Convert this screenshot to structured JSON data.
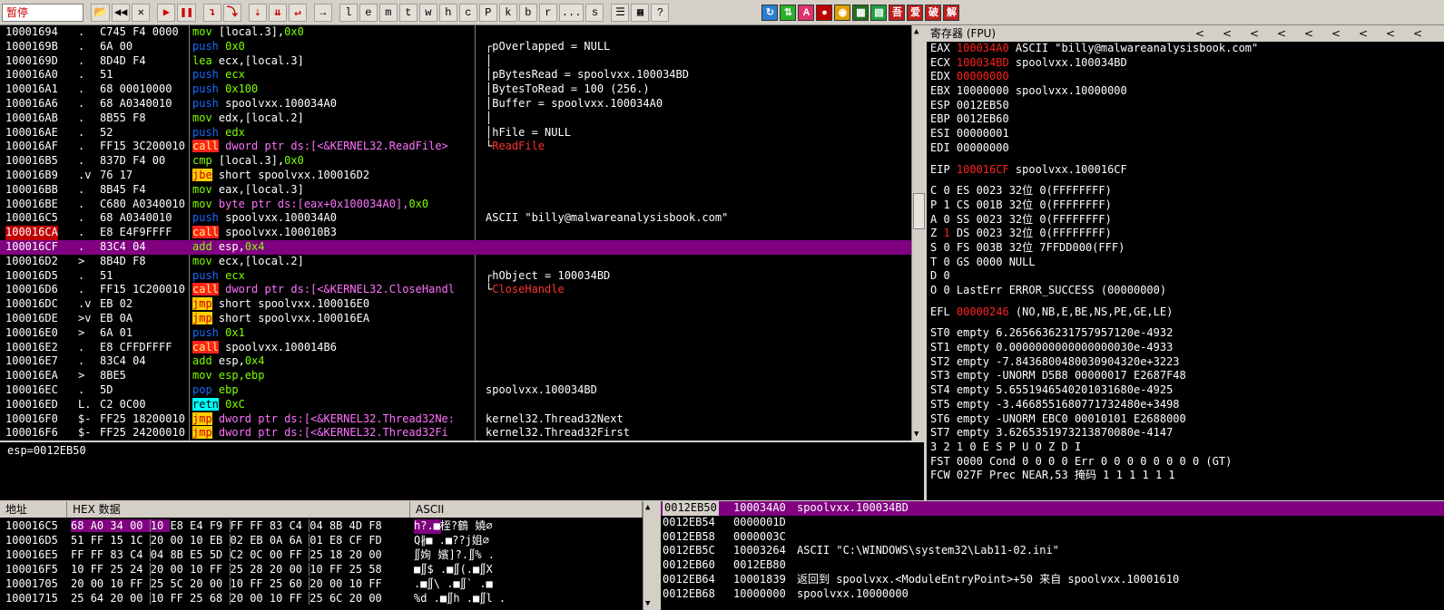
{
  "toolbar": {
    "status": "暂停",
    "buttons": [
      "l",
      "e",
      "m",
      "t",
      "w",
      "h",
      "c",
      "P",
      "k",
      "b",
      "r",
      "...",
      "s"
    ]
  },
  "cpu": {
    "rows": [
      {
        "addr": "10001694",
        "arrow": ".",
        "hex": "C745 F4 0000",
        "dis": [
          [
            "mov",
            "kwmov"
          ],
          [
            " [local.3],",
            "op"
          ],
          [
            "0x0",
            "lit"
          ]
        ],
        "com": ""
      },
      {
        "addr": "1000169B",
        "arrow": ".",
        "hex": "6A 00",
        "dis": [
          [
            "push",
            "kw"
          ],
          [
            " 0x0",
            "lit"
          ]
        ],
        "com": "┌pOverlapped = NULL"
      },
      {
        "addr": "1000169D",
        "arrow": ".",
        "hex": "8D4D F4",
        "dis": [
          [
            "lea",
            "kwmov"
          ],
          [
            " ecx,[local.3]",
            "op"
          ]
        ],
        "com": "│"
      },
      {
        "addr": "100016A0",
        "arrow": ".",
        "hex": "51",
        "dis": [
          [
            "push",
            "kw"
          ],
          [
            " ecx",
            "kwmov"
          ]
        ],
        "com": "│pBytesRead = spoolvxx.100034BD"
      },
      {
        "addr": "100016A1",
        "arrow": ".",
        "hex": "68 00010000",
        "dis": [
          [
            "push",
            "kw"
          ],
          [
            " 0x100",
            "lit"
          ]
        ],
        "com": "│BytesToRead = 100 (256.)"
      },
      {
        "addr": "100016A6",
        "arrow": ".",
        "hex": "68 A0340010",
        "dis": [
          [
            "push",
            "kw"
          ],
          [
            " spoolvxx.100034A0",
            "op"
          ]
        ],
        "com": "│Buffer = spoolvxx.100034A0"
      },
      {
        "addr": "100016AB",
        "arrow": ".",
        "hex": "8B55 F8",
        "dis": [
          [
            "mov",
            "kwmov"
          ],
          [
            " edx,[local.2]",
            "op"
          ]
        ],
        "com": "│"
      },
      {
        "addr": "100016AE",
        "arrow": ".",
        "hex": "52",
        "dis": [
          [
            "push",
            "kw"
          ],
          [
            " edx",
            "kwmov"
          ]
        ],
        "com": "│hFile = NULL"
      },
      {
        "addr": "100016AF",
        "arrow": ".",
        "hex": "FF15 3C200010",
        "dis": [
          [
            "call",
            "kwcall"
          ],
          [
            " dword ptr ds:[<&KERNEL32.ReadFile>",
            "mem"
          ]
        ],
        "com": "└ReadFile",
        "comred": true
      },
      {
        "addr": "100016B5",
        "arrow": ".",
        "hex": "837D F4 00",
        "dis": [
          [
            "cmp",
            "kwcmp"
          ],
          [
            " [local.3],",
            "op"
          ],
          [
            "0x0",
            "lit"
          ]
        ],
        "com": ""
      },
      {
        "addr": "100016B9",
        "arrow": ".v",
        "hex": "76 17",
        "dis": [
          [
            "jbe",
            "kwjmp"
          ],
          [
            " short spoolvxx.100016D2",
            "op"
          ]
        ],
        "com": ""
      },
      {
        "addr": "100016BB",
        "arrow": ".",
        "hex": "8B45 F4",
        "dis": [
          [
            "mov",
            "kwmov"
          ],
          [
            " eax,[local.3]",
            "op"
          ]
        ],
        "com": ""
      },
      {
        "addr": "100016BE",
        "arrow": ".",
        "hex": "C680 A0340010",
        "dis": [
          [
            "mov",
            "kwmov"
          ],
          [
            " byte ptr ds:[eax+0x100034A0],",
            "mem"
          ],
          [
            "0x0",
            "lit"
          ]
        ],
        "com": ""
      },
      {
        "addr": "100016C5",
        "arrow": ".",
        "hex": "68 A0340010",
        "dis": [
          [
            "push",
            "kw"
          ],
          [
            " spoolvxx.100034A0",
            "op"
          ]
        ],
        "com": "ASCII \"billy@malwareanalysisbook.com\""
      },
      {
        "addr": "100016CA",
        "arrow": ".",
        "hex": "E8 E4F9FFFF",
        "dis": [
          [
            "call",
            "kwcall"
          ],
          [
            " spoolvxx.100010B3",
            "op"
          ]
        ],
        "com": "",
        "addrhl": true
      },
      {
        "addr": "100016CF",
        "arrow": ".",
        "hex": "83C4 04",
        "dis": [
          [
            "add",
            "kwmov"
          ],
          [
            " esp,",
            "op"
          ],
          [
            "0x4",
            "lit"
          ]
        ],
        "com": "",
        "sel": true
      },
      {
        "addr": "100016D2",
        "arrow": ">",
        "hex": "8B4D F8",
        "dis": [
          [
            "mov",
            "kwmov"
          ],
          [
            " ecx,[local.2]",
            "op"
          ]
        ],
        "com": ""
      },
      {
        "addr": "100016D5",
        "arrow": ".",
        "hex": "51",
        "dis": [
          [
            "push",
            "kw"
          ],
          [
            " ecx",
            "kwmov"
          ]
        ],
        "com": "┌hObject = 100034BD"
      },
      {
        "addr": "100016D6",
        "arrow": ".",
        "hex": "FF15 1C200010",
        "dis": [
          [
            "call",
            "kwcall"
          ],
          [
            " dword ptr ds:[<&KERNEL32.CloseHandl",
            "mem"
          ]
        ],
        "com": "└CloseHandle",
        "comred": true
      },
      {
        "addr": "100016DC",
        "arrow": ".v",
        "hex": "EB 02",
        "dis": [
          [
            "jmp",
            "kwjmp"
          ],
          [
            " short spoolvxx.100016E0",
            "op"
          ]
        ],
        "com": ""
      },
      {
        "addr": "100016DE",
        "arrow": ">v",
        "hex": "EB 0A",
        "dis": [
          [
            "jmp",
            "kwjmp"
          ],
          [
            " short spoolvxx.100016EA",
            "op"
          ]
        ],
        "com": ""
      },
      {
        "addr": "100016E0",
        "arrow": ">",
        "hex": "6A 01",
        "dis": [
          [
            "push",
            "kw"
          ],
          [
            " 0x1",
            "lit"
          ]
        ],
        "com": ""
      },
      {
        "addr": "100016E2",
        "arrow": ".",
        "hex": "E8 CFFDFFFF",
        "dis": [
          [
            "call",
            "kwcall"
          ],
          [
            " spoolvxx.100014B6",
            "op"
          ]
        ],
        "com": ""
      },
      {
        "addr": "100016E7",
        "arrow": ".",
        "hex": "83C4 04",
        "dis": [
          [
            "add",
            "kwmov"
          ],
          [
            " esp,",
            "op"
          ],
          [
            "0x4",
            "lit"
          ]
        ],
        "com": ""
      },
      {
        "addr": "100016EA",
        "arrow": ">",
        "hex": "8BE5",
        "dis": [
          [
            "mov",
            "kwmov"
          ],
          [
            " esp,ebp",
            "kwmov"
          ]
        ],
        "com": ""
      },
      {
        "addr": "100016EC",
        "arrow": ".",
        "hex": "5D",
        "dis": [
          [
            "pop",
            "kw"
          ],
          [
            " ebp",
            "kwmov"
          ]
        ],
        "com": "spoolvxx.100034BD"
      },
      {
        "addr": "100016ED",
        "arrow": "L.",
        "hex": "C2 0C00",
        "dis": [
          [
            "retn",
            "kwretn"
          ],
          [
            " 0xC",
            "lit"
          ]
        ],
        "com": ""
      },
      {
        "addr": "100016F0",
        "arrow": "$-",
        "hex": "FF25 18200010",
        "dis": [
          [
            "jmp",
            "kwjmp"
          ],
          [
            " dword ptr ds:[<&KERNEL32.Thread32Ne:",
            "mem"
          ]
        ],
        "com": "kernel32.Thread32Next"
      },
      {
        "addr": "100016F6",
        "arrow": "$-",
        "hex": "FF25 24200010",
        "dis": [
          [
            "jmp",
            "kwjmp"
          ],
          [
            " dword ptr ds:[<&KERNEL32.Thread32Fi",
            "mem"
          ]
        ],
        "com": "kernel32.Thread32First"
      }
    ]
  },
  "info": {
    "text": "esp=0012EB50"
  },
  "regs": {
    "title": "寄存器 (FPU)",
    "nav": [
      "<",
      "<",
      "<",
      "<",
      "<",
      "<",
      "<",
      "<",
      "<"
    ],
    "lines": [
      [
        [
          "EAX ",
          ""
        ],
        [
          "100034A0",
          "red"
        ],
        [
          " ASCII \"billy@malwareanalysisbook.com\"",
          ""
        ]
      ],
      [
        [
          "ECX ",
          ""
        ],
        [
          "100034BD",
          "red"
        ],
        [
          " spoolvxx.100034BD",
          ""
        ]
      ],
      [
        [
          "EDX ",
          ""
        ],
        [
          "00000000",
          "red"
        ]
      ],
      [
        [
          "EBX 10000000 spoolvxx.10000000",
          ""
        ]
      ],
      [
        [
          "ESP 0012EB50",
          ""
        ]
      ],
      [
        [
          "EBP 0012EB60",
          ""
        ]
      ],
      [
        [
          "ESI 00000001",
          ""
        ]
      ],
      [
        [
          "EDI 00000000",
          ""
        ]
      ],
      [
        [
          "",
          ""
        ]
      ],
      [
        [
          "EIP ",
          ""
        ],
        [
          "100016CF",
          "red"
        ],
        [
          " spoolvxx.100016CF",
          ""
        ]
      ],
      [
        [
          "",
          ""
        ]
      ],
      [
        [
          "C 0  ES 0023 32位 0(FFFFFFFF)",
          ""
        ]
      ],
      [
        [
          "P 1  CS 001B 32位 0(FFFFFFFF)",
          ""
        ]
      ],
      [
        [
          "A 0  SS 0023 32位 0(FFFFFFFF)",
          ""
        ]
      ],
      [
        [
          "Z ",
          ""
        ],
        [
          "1",
          "red"
        ],
        [
          "  DS 0023 32位 0(FFFFFFFF)",
          ""
        ]
      ],
      [
        [
          "S 0  FS 003B 32位 7FFDD000(FFF)",
          ""
        ]
      ],
      [
        [
          "T 0  GS 0000 NULL",
          ""
        ]
      ],
      [
        [
          "D 0",
          ""
        ]
      ],
      [
        [
          "O 0  LastErr ERROR_SUCCESS (00000000)",
          ""
        ]
      ],
      [
        [
          "",
          ""
        ]
      ],
      [
        [
          "EFL ",
          ""
        ],
        [
          "00000246",
          "red"
        ],
        [
          " (NO,NB,E,BE,NS,PE,GE,LE)",
          ""
        ]
      ],
      [
        [
          "",
          ""
        ]
      ],
      [
        [
          "ST0 empty 6.2656636231757957120e-4932",
          ""
        ]
      ],
      [
        [
          "ST1 empty 0.0000000000000000030e-4933",
          ""
        ]
      ],
      [
        [
          "ST2 empty -7.8436800480030904320e+3223",
          ""
        ]
      ],
      [
        [
          "ST3 empty -UNORM D5B8 00000017 E2687F48",
          ""
        ]
      ],
      [
        [
          "ST4 empty 5.6551946540201031680e-4925",
          ""
        ]
      ],
      [
        [
          "ST5 empty -3.4668551680771732480e+3498",
          ""
        ]
      ],
      [
        [
          "ST6 empty -UNORM EBC0 00010101 E2688000",
          ""
        ]
      ],
      [
        [
          "ST7 empty 3.6265351973213870080e-4147",
          ""
        ]
      ],
      [
        [
          "              3 2 1 0      E S P U O Z D I",
          ""
        ]
      ],
      [
        [
          "FST 0000  Cond 0 0 0 0  Err 0 0 0 0 0 0 0 0  (GT)",
          ""
        ]
      ],
      [
        [
          "FCW 027F  Prec NEAR,53  掩码    1 1 1 1 1 1",
          ""
        ]
      ]
    ]
  },
  "dump": {
    "headers": {
      "addr": "地址",
      "hex": "HEX 数据",
      "ascii": "ASCII"
    },
    "rows": [
      {
        "addr": "100016C5",
        "hex": "68 A0 34 00 10 E8 E4 F9 FF FF 83 C4 04 8B 4D F8",
        "ascii": "h?.■桎?鶴 嬈∅"
      },
      {
        "addr": "100016D5",
        "hex": "51 FF 15 1C 20 00 10 EB 02 EB 0A 6A 01 E8 CF FD",
        "ascii": "Q∦■ .■??j姐∅"
      },
      {
        "addr": "100016E5",
        "hex": "FF FF 83 C4 04 8B E5 5D C2 0C 00 FF 25 18 20 00",
        "ascii": "∬姰 嬪]?.∬% ."
      },
      {
        "addr": "100016F5",
        "hex": "10 FF 25 24 20 00 10 FF 25 28 20 00 10 FF 25 58",
        "ascii": "■∬$ .■∬(.■∬X"
      },
      {
        "addr": "10001705",
        "hex": "20 00 10 FF 25 5C 20 00 10 FF 25 60 20 00 10 FF",
        "ascii": " .■∬\\ .■∬` .■"
      },
      {
        "addr": "10001715",
        "hex": "25 64 20 00 10 FF 25 68 20 00 10 FF 25 6C 20 00",
        "ascii": "%d .■∬h .■∬l ."
      }
    ]
  },
  "stack": {
    "rows": [
      {
        "addr": "0012EB50",
        "val": "100034A0",
        "com": "spoolvxx.100034BD",
        "sel": true
      },
      {
        "addr": "0012EB54",
        "val": "0000001D",
        "com": ""
      },
      {
        "addr": "0012EB58",
        "val": "0000003C",
        "com": ""
      },
      {
        "addr": "0012EB5C",
        "val": "10003264",
        "com": "ASCII \"C:\\WINDOWS\\system32\\Lab11-02.ini\""
      },
      {
        "addr": "0012EB60",
        "val": "0012EB80",
        "com": ""
      },
      {
        "addr": "0012EB64",
        "val": "10001839",
        "com": "返回到 spoolvxx.<ModuleEntryPoint>+50 来自 spoolvxx.10001610"
      },
      {
        "addr": "0012EB68",
        "val": "10000000",
        "com": "spoolvxx.10000000"
      }
    ]
  }
}
